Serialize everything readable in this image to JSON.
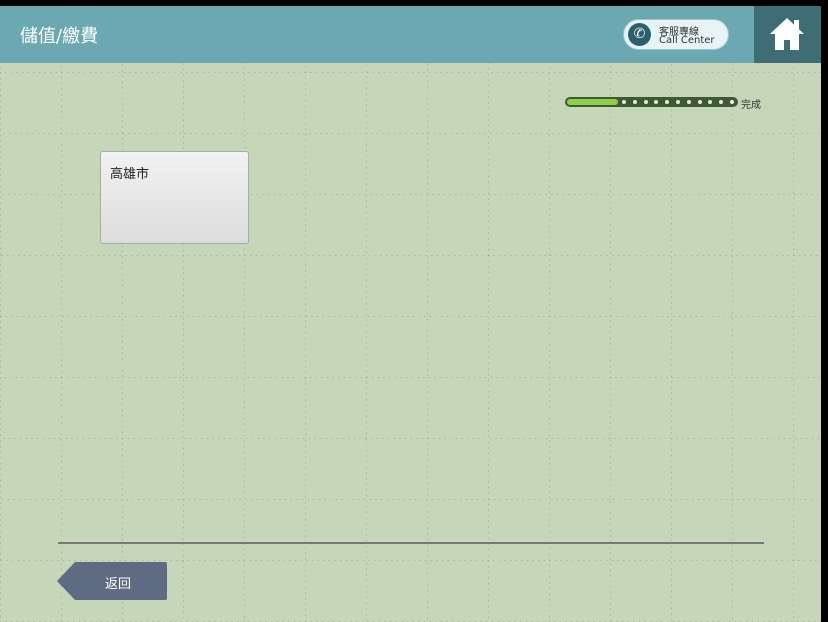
{
  "header": {
    "title": "儲值/繳費",
    "call_center": {
      "line1": "客服專線",
      "line2": "Call Center",
      "icon": "phone-icon"
    },
    "home_icon": "home-icon"
  },
  "progress": {
    "fraction": 0.3,
    "label": "完成",
    "steps_remaining": 11
  },
  "city_card": {
    "label": "高雄市"
  },
  "footer": {
    "back_label": "返回"
  },
  "colors": {
    "background": "#c5d7b8",
    "header": "#6ba8b1",
    "home": "#3f6d76",
    "progress_fill": "#8ed04c",
    "back_button": "#5f6b82"
  }
}
